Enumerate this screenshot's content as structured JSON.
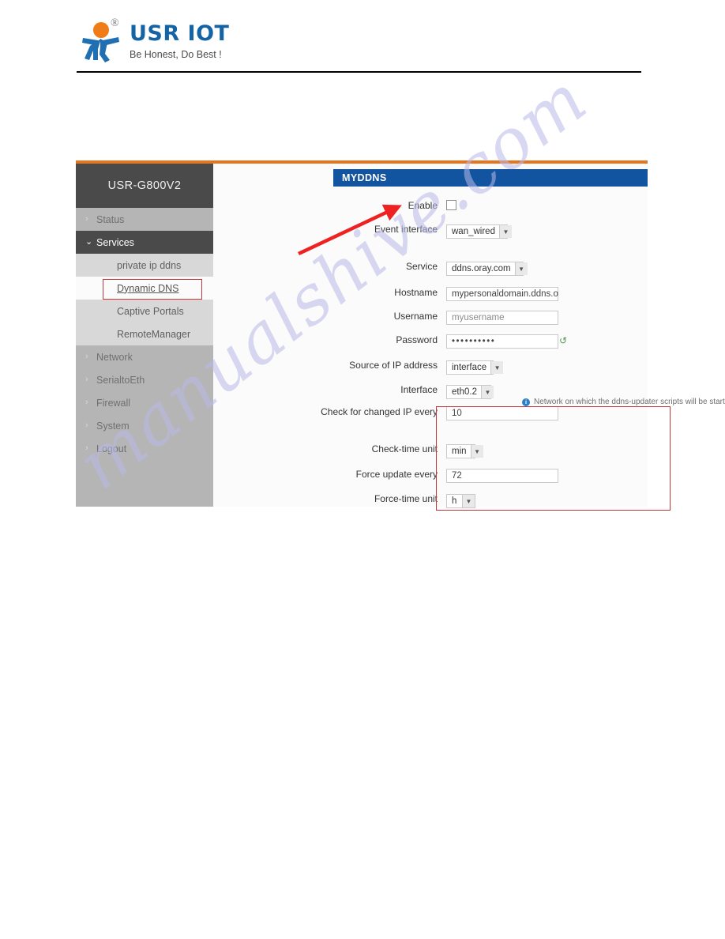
{
  "document": {
    "brand_name": "USR IOT",
    "brand_slogan": "Be Honest, Do Best !",
    "registered_mark": "®",
    "watermark": "manualshive.com"
  },
  "router_ui": {
    "device_title": "USR-G800V2",
    "panel_title": "MYDDNS",
    "sidebar": {
      "items": [
        {
          "label": "Status",
          "type": "group",
          "caret": "›",
          "state": "collapsed"
        },
        {
          "label": "Services",
          "type": "group",
          "caret": "⌄",
          "state": "expanded"
        },
        {
          "label": "private ip ddns",
          "type": "sub",
          "caret": "",
          "state": "normal"
        },
        {
          "label": "Dynamic DNS",
          "type": "sub",
          "caret": "",
          "state": "current"
        },
        {
          "label": "Captive Portals",
          "type": "sub",
          "caret": "",
          "state": "normal"
        },
        {
          "label": "RemoteManager",
          "type": "sub",
          "caret": "",
          "state": "normal"
        },
        {
          "label": "Network",
          "type": "group",
          "caret": "›",
          "state": "collapsed"
        },
        {
          "label": "SerialtoEth",
          "type": "group",
          "caret": "›",
          "state": "collapsed"
        },
        {
          "label": "Firewall",
          "type": "group",
          "caret": "›",
          "state": "collapsed"
        },
        {
          "label": "System",
          "type": "group",
          "caret": "›",
          "state": "collapsed"
        },
        {
          "label": "Logout",
          "type": "group",
          "caret": "›",
          "state": "collapsed"
        }
      ]
    },
    "form": {
      "enable": {
        "label": "Enable",
        "checked": false
      },
      "event_interface": {
        "label": "Event interface",
        "value": "wan_wired"
      },
      "event_interface_hint": "Network on which the ddns-updater scripts will be started",
      "service": {
        "label": "Service",
        "value": "ddns.oray.com"
      },
      "hostname": {
        "label": "Hostname",
        "value": "mypersonaldomain.ddns.o"
      },
      "username": {
        "label": "Username",
        "value": "myusername"
      },
      "password": {
        "label": "Password",
        "value": "••••••••••"
      },
      "source_of_ip": {
        "label": "Source of IP address",
        "value": "interface"
      },
      "interface": {
        "label": "Interface",
        "value": "eth0.2"
      },
      "check_interval": {
        "label": "Check for changed IP every",
        "value": "10"
      },
      "check_time_unit": {
        "label": "Check-time unit",
        "value": "min"
      },
      "force_update": {
        "label": "Force update every",
        "value": "72"
      },
      "force_time_unit": {
        "label": "Force-time unit",
        "value": "h"
      }
    },
    "colors": {
      "accent_orange": "#e3761f",
      "panel_blue": "#12549f",
      "highlight_red": "#c4363c",
      "sidebar_gray": "#b5b5b5",
      "sidebar_dark": "#4a4a4a"
    }
  }
}
